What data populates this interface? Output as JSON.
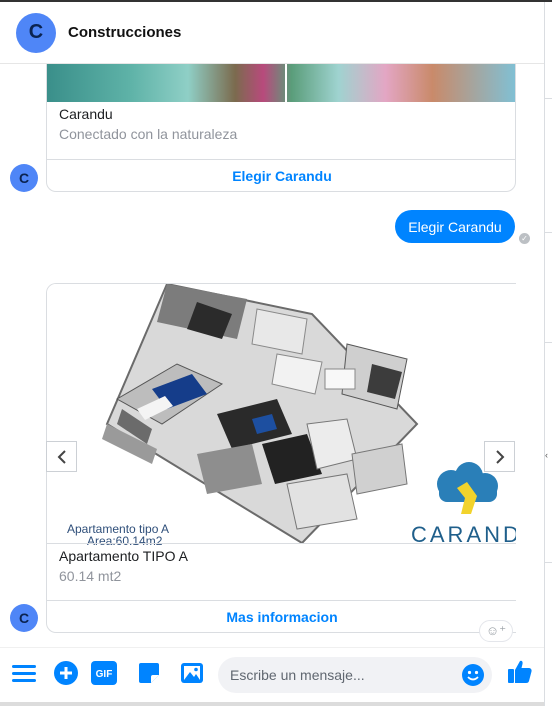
{
  "header": {
    "avatar_letter": "C",
    "title": "Construcciones"
  },
  "bot_avatar_letter": "C",
  "card1": {
    "title": "Carandu",
    "subtitle": "Conectado con la naturaleza",
    "button_label": "Elegir Carandu"
  },
  "sent_message": {
    "text": "Elegir Carandu"
  },
  "card2": {
    "image_caption_line1": "Apartamento tipo A",
    "image_caption_line2": "Area:60.14m2",
    "logo_text": "CARAND",
    "title": "Apartamento TIPO A",
    "subtitle": "60.14 mt2",
    "button_label": "Mas informacion"
  },
  "composer": {
    "placeholder": "Escribe un mensaje..."
  },
  "colors": {
    "accent": "#0084ff",
    "avatar": "#4f86f7",
    "logo_blue": "#2a7fb8",
    "logo_yellow": "#f2d32c"
  }
}
